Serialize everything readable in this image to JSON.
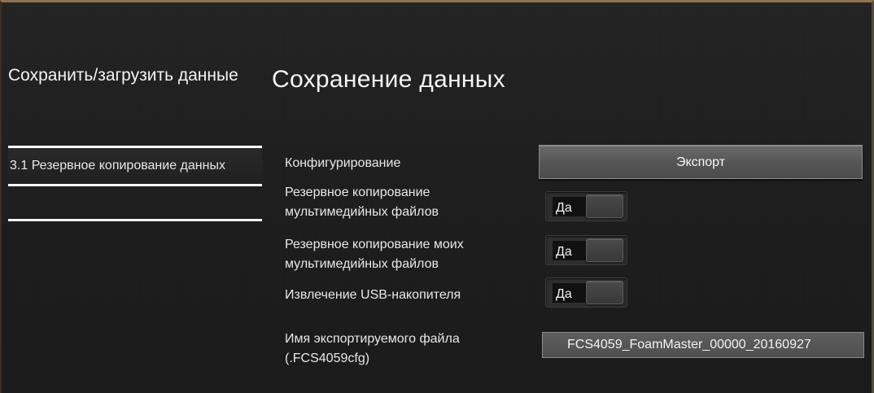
{
  "sidebar": {
    "title": "Сохранить/загрузить данные",
    "items": [
      {
        "label": "3.1 Резервное копирование данных",
        "active": true
      }
    ]
  },
  "main": {
    "title": "Сохранение данных",
    "rows": {
      "config": {
        "label": "Конфигурирование",
        "button_label": "Экспорт"
      },
      "media_backup": {
        "label": "Резервное копирование мультимедийных файлов",
        "toggle_value": "Да"
      },
      "my_media_backup": {
        "label": "Резервное копирование моих мультимедийных файлов",
        "toggle_value": "Да"
      },
      "usb_eject": {
        "label": "Извлечение USB-накопителя",
        "toggle_value": "Да"
      },
      "export_filename": {
        "label": "Имя экспортируемого файла (.FCS4059cfg)",
        "value": "FCS4059_FoamMaster_00000_20160927"
      }
    }
  },
  "colors": {
    "frame_accent": "#8a7452",
    "background": "#1c1c1c",
    "button": "#555555",
    "text": "#ffffff"
  }
}
